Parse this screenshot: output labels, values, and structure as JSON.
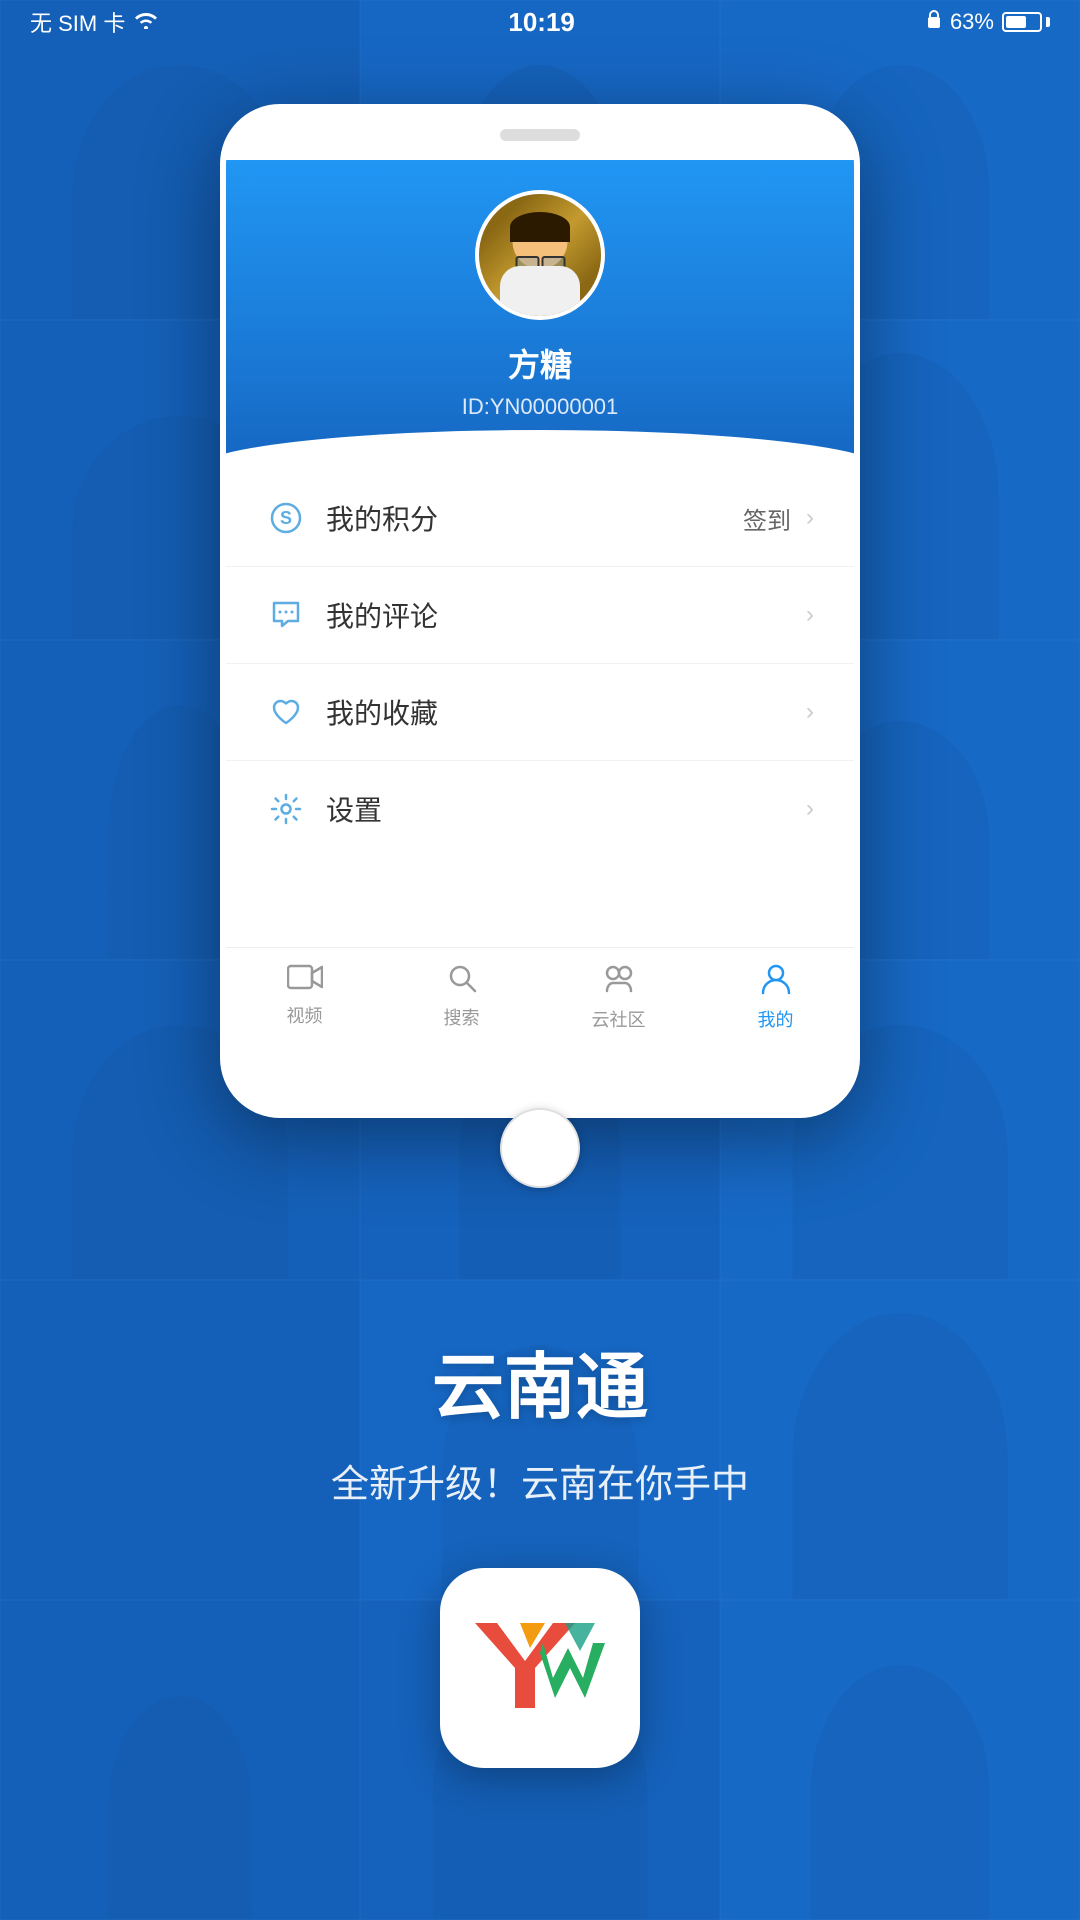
{
  "statusBar": {
    "carrier": "无 SIM 卡",
    "wifi": "WiFi",
    "time": "10:19",
    "lock": "🔒",
    "battery": "63%"
  },
  "profile": {
    "name": "方糖",
    "id": "ID:YN00000001",
    "avatarAlt": "用户头像"
  },
  "menu": {
    "items": [
      {
        "id": "points",
        "icon": "S",
        "label": "我的积分",
        "rightLabel": "签到",
        "hasChevron": true
      },
      {
        "id": "comments",
        "icon": "💬",
        "label": "我的评论",
        "rightLabel": "",
        "hasChevron": true
      },
      {
        "id": "favorites",
        "icon": "♡",
        "label": "我的收藏",
        "rightLabel": "",
        "hasChevron": true
      },
      {
        "id": "settings",
        "icon": "⚙",
        "label": "设置",
        "rightLabel": "",
        "hasChevron": true
      }
    ],
    "checkinLabel": "签到"
  },
  "bottomNav": {
    "items": [
      {
        "id": "video",
        "icon": "video",
        "label": "视频",
        "active": false
      },
      {
        "id": "search",
        "icon": "search",
        "label": "搜索",
        "active": false
      },
      {
        "id": "community",
        "icon": "community",
        "label": "云社区",
        "active": false
      },
      {
        "id": "mine",
        "icon": "mine",
        "label": "我的",
        "active": true
      }
    ]
  },
  "appPromo": {
    "title": "云南通",
    "subtitle": "全新升级！云南在你手中"
  }
}
